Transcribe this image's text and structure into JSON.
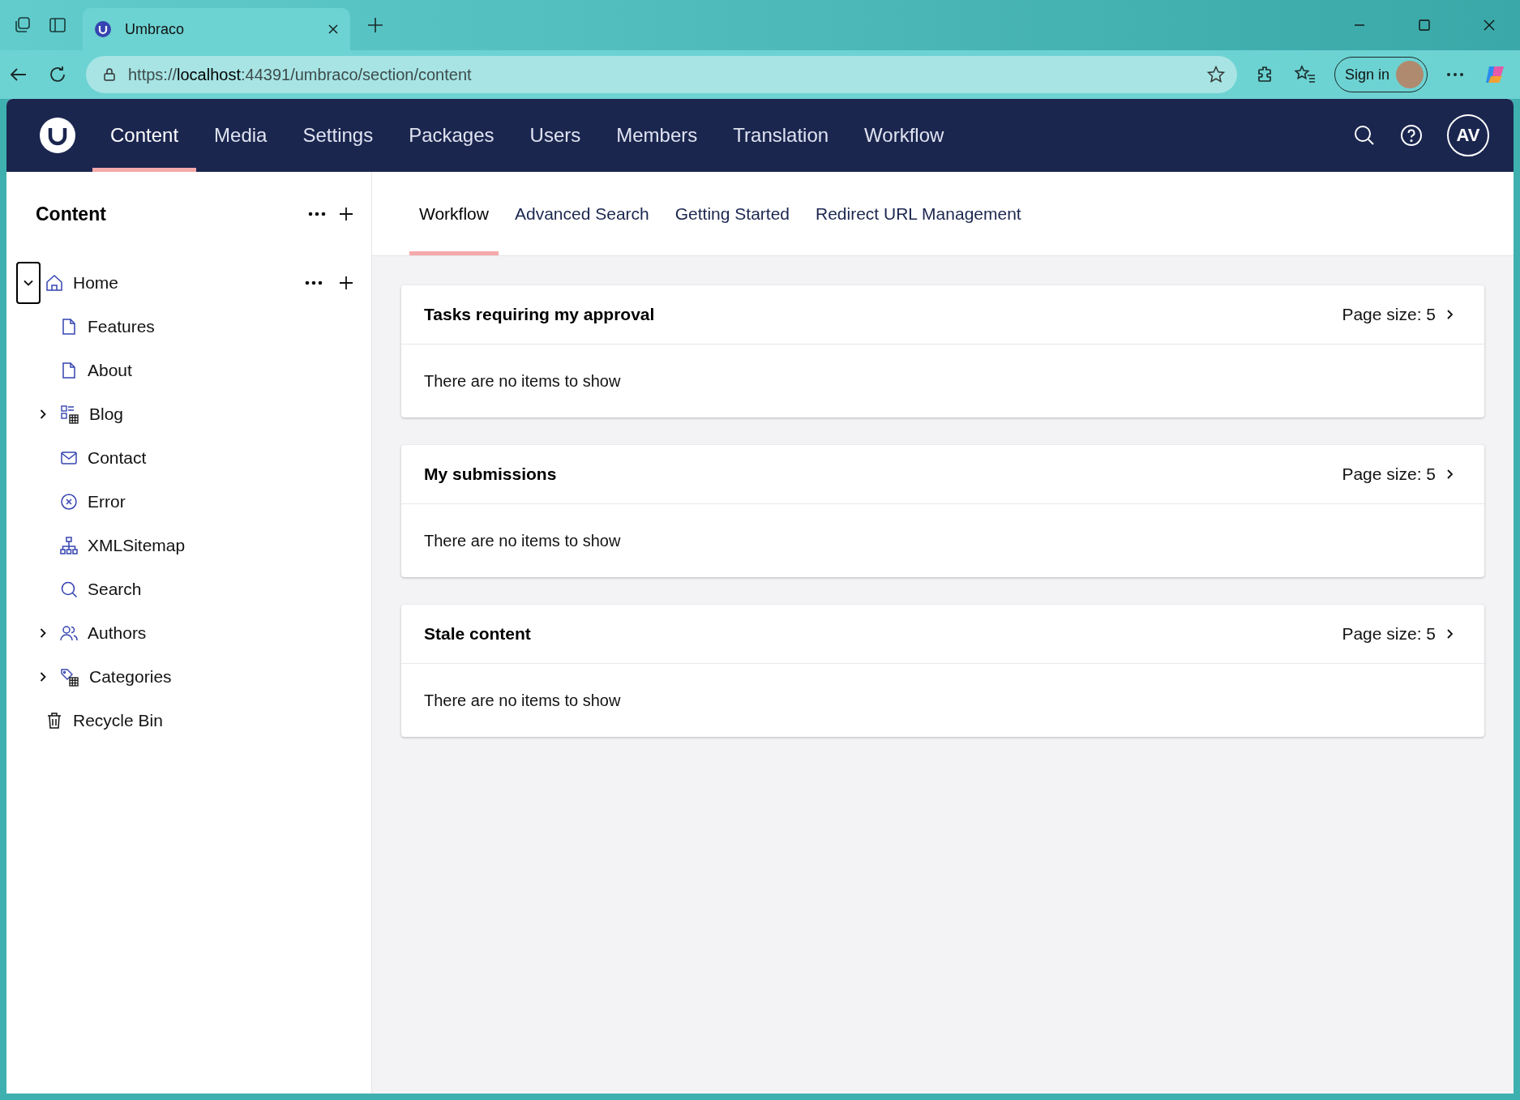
{
  "browser": {
    "tab": {
      "title": "Umbraco"
    },
    "url": {
      "prefix": "https://",
      "host": "localhost",
      "suffix": ":44391/umbraco/section/content"
    },
    "sign_in": "Sign in"
  },
  "header": {
    "sections": [
      {
        "label": "Content",
        "selected": true
      },
      {
        "label": "Media",
        "selected": false
      },
      {
        "label": "Settings",
        "selected": false
      },
      {
        "label": "Packages",
        "selected": false
      },
      {
        "label": "Users",
        "selected": false
      },
      {
        "label": "Members",
        "selected": false
      },
      {
        "label": "Translation",
        "selected": false
      },
      {
        "label": "Workflow",
        "selected": false
      }
    ],
    "avatar": "AV"
  },
  "sidebar": {
    "title": "Content",
    "tree": [
      {
        "label": "Home",
        "kind": "home",
        "expanded": true,
        "focused": true,
        "children": [
          {
            "label": "Features",
            "kind": "document"
          },
          {
            "label": "About",
            "kind": "document"
          },
          {
            "label": "Blog",
            "kind": "list",
            "expanded": false,
            "focused": false
          },
          {
            "label": "Contact",
            "kind": "mail"
          },
          {
            "label": "Error",
            "kind": "error"
          },
          {
            "label": "XMLSitemap",
            "kind": "sitemap"
          },
          {
            "label": "Search",
            "kind": "search"
          },
          {
            "label": "Authors",
            "kind": "users",
            "expanded": false,
            "focused": false
          },
          {
            "label": "Categories",
            "kind": "tags",
            "expanded": false,
            "focused": false
          }
        ]
      },
      {
        "label": "Recycle Bin",
        "kind": "trash"
      }
    ]
  },
  "tabs": [
    {
      "label": "Workflow",
      "selected": true
    },
    {
      "label": "Advanced Search",
      "selected": false
    },
    {
      "label": "Getting Started",
      "selected": false
    },
    {
      "label": "Redirect URL Management",
      "selected": false
    }
  ],
  "cards": [
    {
      "title": "Tasks requiring my approval",
      "page_size": "Page size: 5",
      "empty": "There are no items to show"
    },
    {
      "title": "My submissions",
      "page_size": "Page size: 5",
      "empty": "There are no items to show"
    },
    {
      "title": "Stale content",
      "page_size": "Page size: 5",
      "empty": "There are no items to show"
    }
  ]
}
